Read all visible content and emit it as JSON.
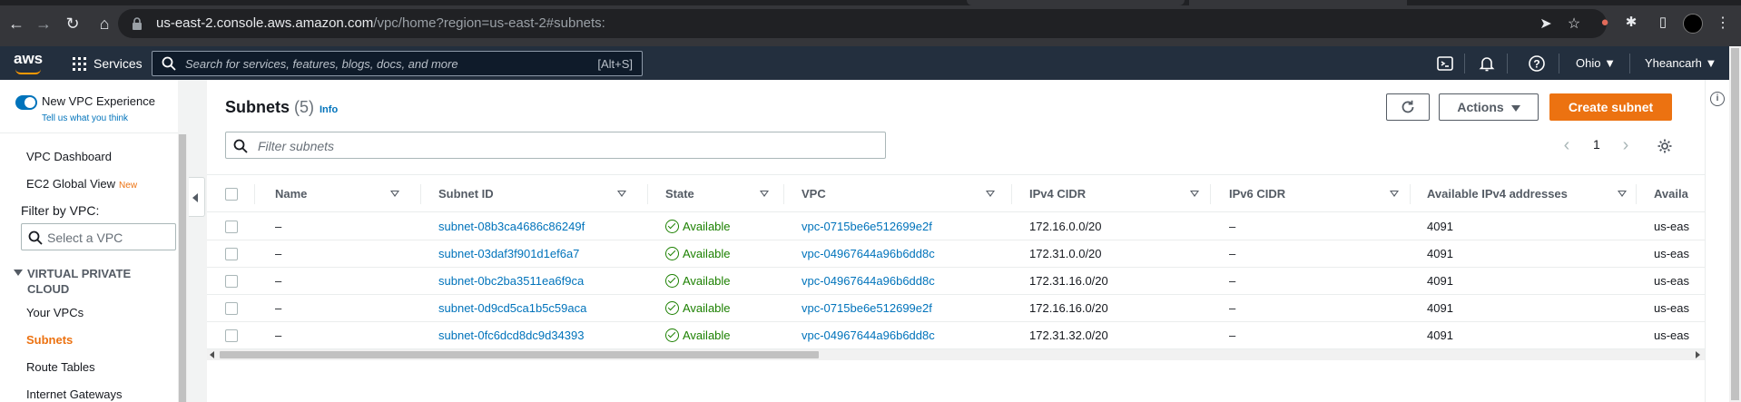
{
  "browser": {
    "url_host": "us-east-2.console.aws.amazon.com",
    "url_path": "/vpc/home?region=us-east-2#subnets:"
  },
  "header": {
    "services_label": "Services",
    "search_placeholder": "Search for services, features, blogs, docs, and more",
    "search_shortcut": "[Alt+S]",
    "region": "Ohio ▼",
    "account": "Yheancarh ▼"
  },
  "sidebar": {
    "new_experience": "New VPC Experience",
    "tell_us": "Tell us what you think",
    "dashboard": "VPC Dashboard",
    "ec2_global": "EC2 Global View",
    "ec2_global_badge": "New",
    "filter_label": "Filter by VPC:",
    "vpc_select_placeholder": "Select a VPC",
    "section_title": "VIRTUAL PRIVATE CLOUD",
    "items": [
      "Your VPCs",
      "Subnets",
      "Route Tables",
      "Internet Gateways"
    ],
    "active_item": "Subnets"
  },
  "main": {
    "title": "Subnets",
    "count": "(5)",
    "info": "Info",
    "actions_label": "Actions",
    "create_label": "Create subnet",
    "filter_placeholder": "Filter subnets",
    "page": "1",
    "columns": [
      "Name",
      "Subnet ID",
      "State",
      "VPC",
      "IPv4 CIDR",
      "IPv6 CIDR",
      "Available IPv4 addresses",
      "Availa"
    ],
    "rows": [
      {
        "name": "–",
        "subnet_id": "subnet-08b3ca4686c86249f",
        "state": "Available",
        "vpc": "vpc-0715be6e512699e2f",
        "ipv4": "172.16.0.0/20",
        "ipv6": "–",
        "avail": "4091",
        "az": "us-eas"
      },
      {
        "name": "–",
        "subnet_id": "subnet-03daf3f901d1ef6a7",
        "state": "Available",
        "vpc": "vpc-04967644a96b6dd8c",
        "ipv4": "172.31.0.0/20",
        "ipv6": "–",
        "avail": "4091",
        "az": "us-eas"
      },
      {
        "name": "–",
        "subnet_id": "subnet-0bc2ba3511ea6f9ca",
        "state": "Available",
        "vpc": "vpc-04967644a96b6dd8c",
        "ipv4": "172.31.16.0/20",
        "ipv6": "–",
        "avail": "4091",
        "az": "us-eas"
      },
      {
        "name": "–",
        "subnet_id": "subnet-0d9cd5ca1b5c59aca",
        "state": "Available",
        "vpc": "vpc-0715be6e512699e2f",
        "ipv4": "172.16.16.0/20",
        "ipv6": "–",
        "avail": "4091",
        "az": "us-eas"
      },
      {
        "name": "–",
        "subnet_id": "subnet-0fc6dcd8dc9d34393",
        "state": "Available",
        "vpc": "vpc-04967644a96b6dd8c",
        "ipv4": "172.31.32.0/20",
        "ipv6": "–",
        "avail": "4091",
        "az": "us-eas"
      }
    ]
  },
  "colors": {
    "aws_header": "#232f3e",
    "primary_button": "#ec7211",
    "link": "#0073bb",
    "status_available": "#1d8102"
  }
}
